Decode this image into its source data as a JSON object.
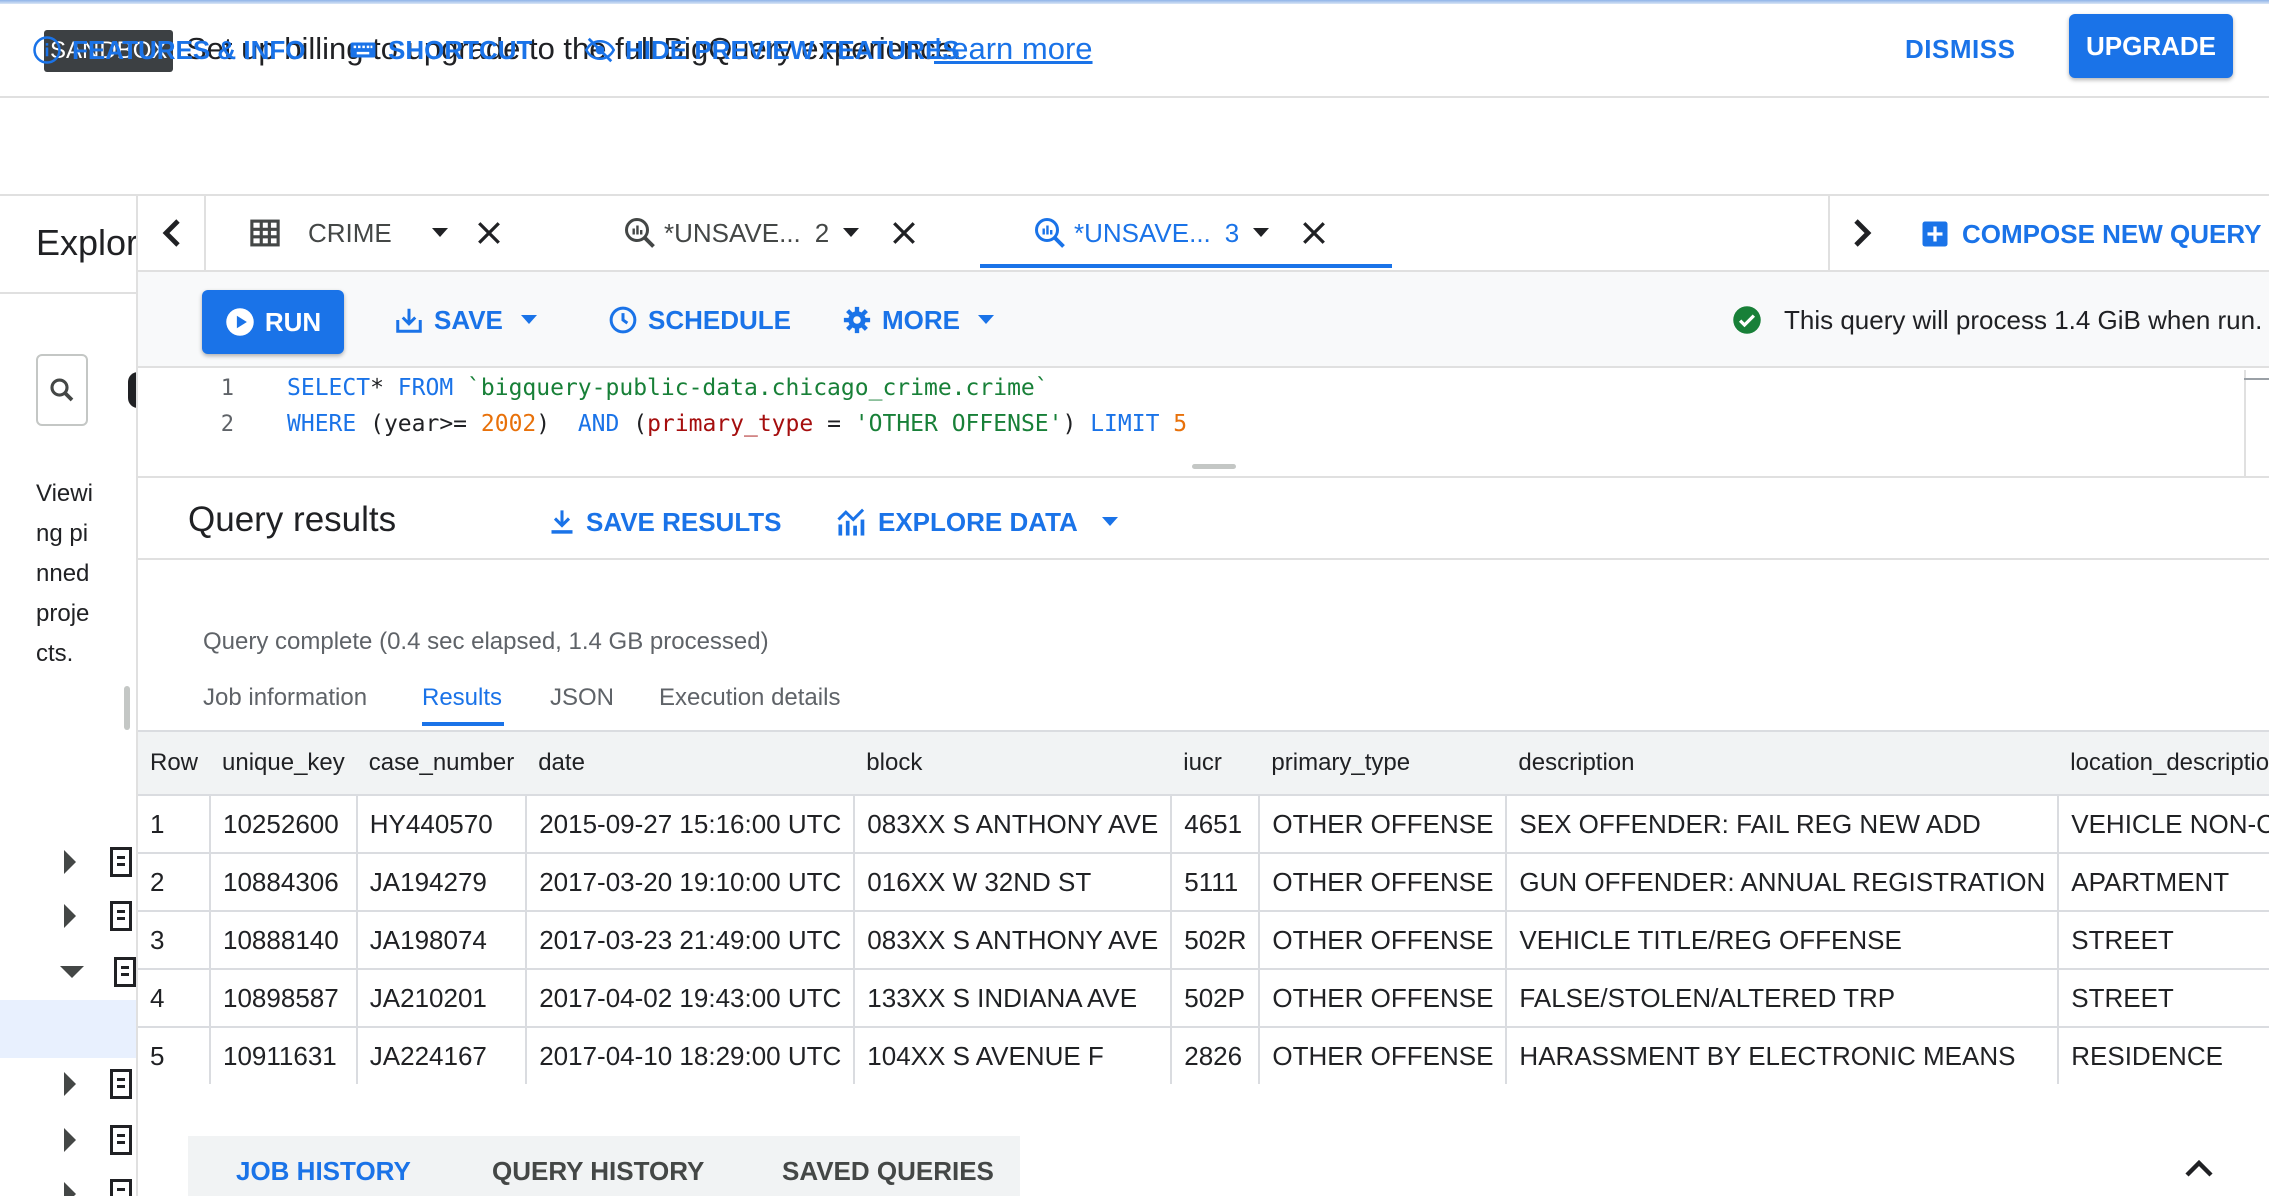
{
  "banner": {
    "badge": "SANDBOX",
    "message": "Set up billing to upgrade to the full BigQuery experience.",
    "link": "Learn more",
    "dismiss": "DISMISS",
    "upgrade": "UPGRADE"
  },
  "featurebar": {
    "features": "FEATURES & INFO",
    "shortcut": "SHORTCUT",
    "hide_preview": "HIDE PREVIEW FEATURES"
  },
  "explorer": {
    "title": "Explorer",
    "pinned_text": "Viewing pinned projects."
  },
  "tabs": [
    {
      "label": "CRIME",
      "suffix": ""
    },
    {
      "label": "*UNSAVE...",
      "suffix": "2"
    },
    {
      "label": "*UNSAVE...",
      "suffix": "3"
    }
  ],
  "compose": "COMPOSE NEW QUERY",
  "toolbar": {
    "run": "RUN",
    "save": "SAVE",
    "schedule": "SCHEDULE",
    "more": "MORE",
    "process_msg": "This query will process 1.4 GiB when run."
  },
  "editor": {
    "line_numbers": [
      "1",
      "2"
    ],
    "line1": {
      "kw1": "SELECT",
      "plain1": "* ",
      "kw2": "FROM",
      "str1": " `bigquery-public-data.chicago_crime.crime`"
    },
    "line2": {
      "kw1": "WHERE",
      "plain1": " (year>= ",
      "num1": "2002",
      "plain2": ")  ",
      "kw2": "AND",
      "plain3": " (",
      "id1": "primary_type",
      "plain4": " = ",
      "str1": "'OTHER OFFENSE'",
      "plain5": ") ",
      "kw3": "LIMIT",
      "num2": " 5"
    }
  },
  "results": {
    "title": "Query results",
    "save_results": "SAVE RESULTS",
    "explore_data": "EXPLORE DATA",
    "status": "Query complete (0.4 sec elapsed, 1.4 GB processed)",
    "tabs": [
      "Job information",
      "Results",
      "JSON",
      "Execution details"
    ],
    "active_tab": "Results",
    "columns": [
      "Row",
      "unique_key",
      "case_number",
      "date",
      "block",
      "iucr",
      "primary_type",
      "description",
      "location_description"
    ],
    "rows": [
      [
        "1",
        "10252600",
        "HY440570",
        "2015-09-27 15:16:00 UTC",
        "083XX S ANTHONY AVE",
        "4651",
        "OTHER OFFENSE",
        "SEX OFFENDER: FAIL REG NEW ADD",
        "VEHICLE NON-COMME"
      ],
      [
        "2",
        "10884306",
        "JA194279",
        "2017-03-20 19:10:00 UTC",
        "016XX W 32ND ST",
        "5111",
        "OTHER OFFENSE",
        "GUN OFFENDER: ANNUAL REGISTRATION",
        "APARTMENT"
      ],
      [
        "3",
        "10888140",
        "JA198074",
        "2017-03-23 21:49:00 UTC",
        "083XX S ANTHONY AVE",
        "502R",
        "OTHER OFFENSE",
        "VEHICLE TITLE/REG OFFENSE",
        "STREET"
      ],
      [
        "4",
        "10898587",
        "JA210201",
        "2017-04-02 19:43:00 UTC",
        "133XX S INDIANA AVE",
        "502P",
        "OTHER OFFENSE",
        "FALSE/STOLEN/ALTERED TRP",
        "STREET"
      ],
      [
        "5",
        "10911631",
        "JA224167",
        "2017-04-10 18:29:00 UTC",
        "104XX S AVENUE F",
        "2826",
        "OTHER OFFENSE",
        "HARASSMENT BY ELECTRONIC MEANS",
        "RESIDENCE"
      ]
    ]
  },
  "bottom": {
    "tabs": [
      "JOB HISTORY",
      "QUERY HISTORY",
      "SAVED QUERIES"
    ],
    "active": "JOB HISTORY"
  },
  "colors": {
    "accent": "#1a73e8",
    "success": "#188038"
  }
}
